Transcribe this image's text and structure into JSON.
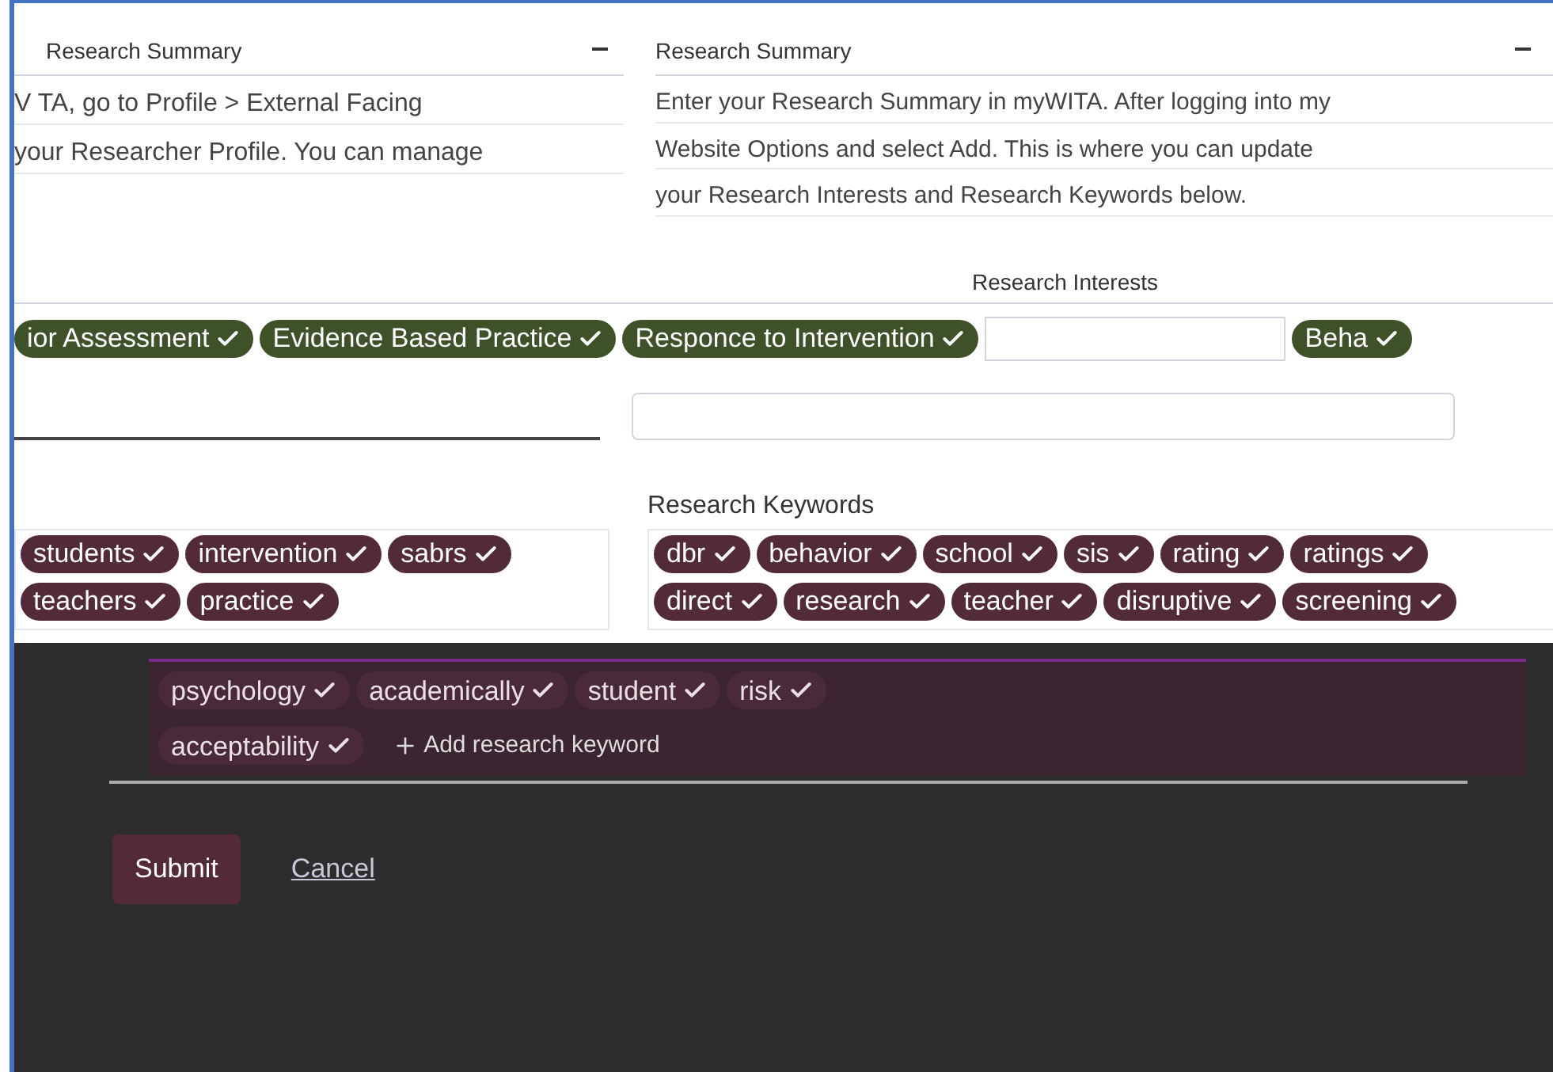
{
  "summary": {
    "left_label": "Research Summary",
    "left_lines": [
      "V TA, go to Profile > External Facing",
      "your Researcher Profile. You can manage"
    ],
    "right_label": "Research Summary",
    "right_lines": [
      "Enter your Research Summary in myWITA. After logging into my",
      "Website Options and select Add. This is where you can update",
      "your Research Interests and Research Keywords below."
    ]
  },
  "interests": {
    "label": "Research Interests",
    "chips": [
      "ior Assessment",
      "Evidence Based Practice",
      "Responce to Intervention"
    ],
    "right_chips": [
      "Beha"
    ]
  },
  "keywords": {
    "label": "Research Keywords",
    "left_rows": [
      [
        "students",
        "intervention",
        "sabrs"
      ],
      [
        "teachers",
        "practice"
      ]
    ],
    "right_rows": [
      [
        "dbr",
        "behavior",
        "school",
        "sis",
        "rating",
        "ratings"
      ],
      [
        "direct",
        "research",
        "teacher",
        "disruptive",
        "screening"
      ]
    ]
  },
  "dark_chips": [
    "psychology",
    "academically",
    "student",
    "risk"
  ],
  "last_chip": "acceptability",
  "add_keyword": "Add research keyword",
  "actions": {
    "submit": "Submit",
    "cancel": "Cancel"
  }
}
